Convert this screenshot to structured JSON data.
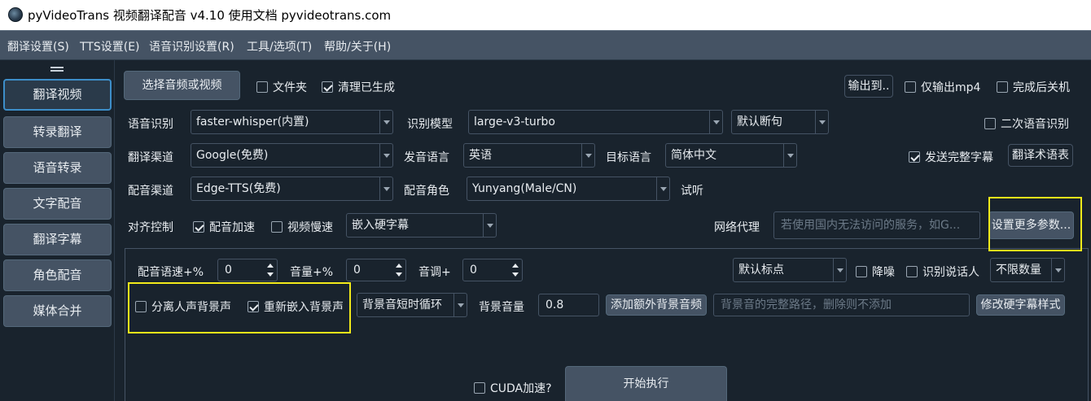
{
  "window": {
    "title": "pyVideoTrans 视频翻译配音 v4.10 使用文档 pyvideotrans.com"
  },
  "menu": [
    "翻译设置(S)",
    "TTS设置(E)",
    "语音识别设置(R)",
    "工具/选项(T)",
    "帮助/关于(H)"
  ],
  "sidebar": {
    "items": [
      {
        "label": "翻译视频",
        "active": true
      },
      {
        "label": "转录翻译"
      },
      {
        "label": "语音转录"
      },
      {
        "label": "文字配音"
      },
      {
        "label": "翻译字幕"
      },
      {
        "label": "角色配音"
      },
      {
        "label": "媒体合并"
      }
    ]
  },
  "toolbar": {
    "select_media": "选择音频或视频",
    "folder": {
      "label": "文件夹",
      "checked": false
    },
    "clean_generated": {
      "label": "清理已生成",
      "checked": true
    },
    "output_to": "输出到..",
    "only_mp4": {
      "label": "仅输出mp4",
      "checked": false
    },
    "shutdown_after": {
      "label": "完成后关机",
      "checked": false
    }
  },
  "recognition": {
    "label": "语音识别",
    "value": "faster-whisper(内置)",
    "model_label": "识别模型",
    "model_value": "large-v3-turbo",
    "split_value": "默认断句",
    "second_pass": {
      "label": "二次语音识别",
      "checked": false
    }
  },
  "translation": {
    "label": "翻译渠道",
    "value": "Google(免费)",
    "source_lang_label": "发音语言",
    "source_lang": "英语",
    "target_lang_label": "目标语言",
    "target_lang": "简体中文",
    "send_full_subs": {
      "label": "发送完整字幕",
      "checked": true
    },
    "glossary_button": "翻译术语表"
  },
  "dubbing": {
    "label": "配音渠道",
    "value": "Edge-TTS(免费)",
    "role_label": "配音角色",
    "role_value": "Yunyang(Male/CN)",
    "listen": "试听"
  },
  "align": {
    "label": "对齐控制",
    "speedup": {
      "label": "配音加速",
      "checked": true
    },
    "slow_video": {
      "label": "视频慢速",
      "checked": false
    },
    "subtitle_mode": "嵌入硬字幕",
    "proxy_label": "网络代理",
    "proxy_placeholder": "若使用国内无法访问的服务，如G...",
    "more_settings": "设置更多参数..."
  },
  "advanced": {
    "speech_rate_label": "配音语速+%",
    "speech_rate": "0",
    "volume_label": "音量+%",
    "volume": "0",
    "pitch_label": "音调+",
    "pitch": "0",
    "punct_value": "默认标点",
    "denoise": {
      "label": "降噪",
      "checked": false
    },
    "speaker_id": {
      "label": "识别说话人",
      "checked": false
    },
    "speaker_count": "不限数量",
    "separate_vocals": {
      "label": "分离人声背景声",
      "checked": false
    },
    "reembed_bg": {
      "label": "重新嵌入背景声",
      "checked": true
    },
    "bg_loop": "背景音短时循环",
    "bg_volume_label": "背景音量",
    "bg_volume": "0.8",
    "add_bg_button": "添加额外背景音频",
    "bg_path_placeholder": "背景音的完整路径，删除则不添加",
    "edit_sub_style": "修改硬字幕样式"
  },
  "footer": {
    "cuda": {
      "label": "CUDA加速?",
      "checked": false
    },
    "start": "开始执行"
  },
  "colors": {
    "highlight": "#f2ea1a",
    "background": "#19232d",
    "button": "#455364",
    "accent": "#3d8ec9"
  }
}
